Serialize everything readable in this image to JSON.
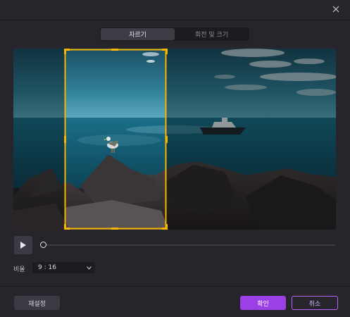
{
  "dialog": {
    "close_icon": "close-icon",
    "tabs": [
      {
        "label": "자르기",
        "active": true
      },
      {
        "label": "회전 및 크기",
        "active": false
      }
    ],
    "controls": {
      "play_icon": "play-icon"
    },
    "ratio": {
      "label": "비율",
      "selected": "9 : 16",
      "dropdown_icon": "chevron-down-icon"
    },
    "buttons": {
      "reset": "재설정",
      "ok": "확인",
      "cancel": "취소"
    },
    "colors": {
      "accent": "#9b3fe6",
      "crop_frame": "#f7b500",
      "background": "#25252b"
    }
  }
}
